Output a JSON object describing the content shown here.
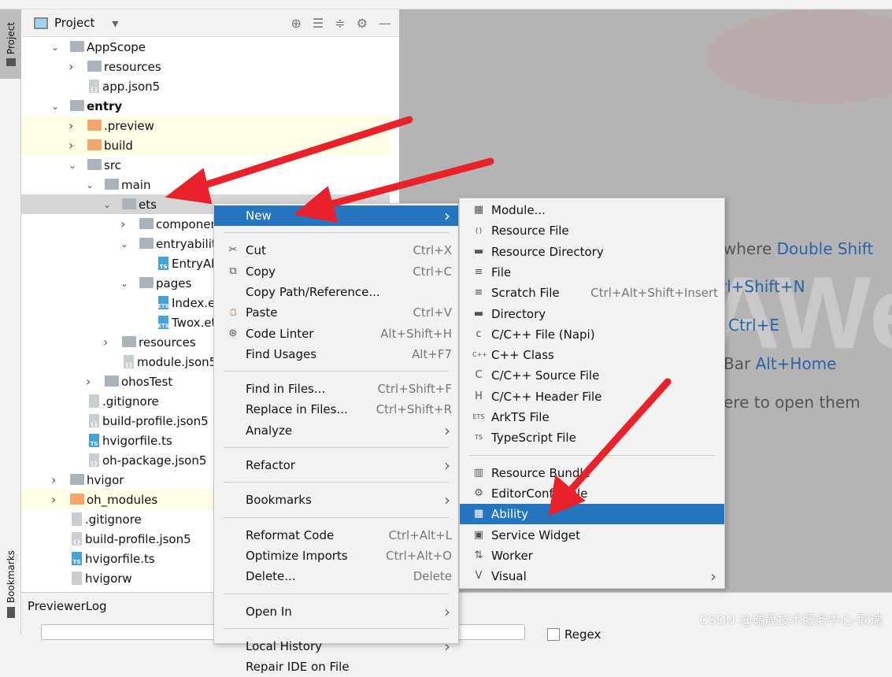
{
  "sidebar_tabs": {
    "project": "Project",
    "bookmarks": "Bookmarks"
  },
  "panel": {
    "title": "Project"
  },
  "tree": [
    {
      "label": "AppScope",
      "level": 0,
      "type": "folder",
      "expanded": true
    },
    {
      "label": "resources",
      "level": 1,
      "type": "folder",
      "expanded": false
    },
    {
      "label": "app.json5",
      "level": 1,
      "type": "json"
    },
    {
      "label": "entry",
      "level": 0,
      "type": "module",
      "expanded": true,
      "bold": true
    },
    {
      "label": ".preview",
      "level": 1,
      "type": "folder-orange",
      "expanded": false,
      "highlight": "yellow"
    },
    {
      "label": "build",
      "level": 1,
      "type": "folder-orange",
      "expanded": false,
      "highlight": "yellow"
    },
    {
      "label": "src",
      "level": 1,
      "type": "folder",
      "expanded": true
    },
    {
      "label": "main",
      "level": 2,
      "type": "folder",
      "expanded": true
    },
    {
      "label": "ets",
      "level": 3,
      "type": "folder",
      "expanded": true,
      "selected": true
    },
    {
      "label": "componen",
      "level": 4,
      "type": "folder",
      "expanded": false
    },
    {
      "label": "entryability",
      "level": 4,
      "type": "folder",
      "expanded": true
    },
    {
      "label": "EntryAb",
      "level": 5,
      "type": "ts"
    },
    {
      "label": "pages",
      "level": 4,
      "type": "folder",
      "expanded": true
    },
    {
      "label": "Index.et",
      "level": 5,
      "type": "ets"
    },
    {
      "label": "Twox.et",
      "level": 5,
      "type": "ets"
    },
    {
      "label": "resources",
      "level": 3,
      "type": "folder",
      "expanded": false
    },
    {
      "label": "module.json5",
      "level": 3,
      "type": "json"
    },
    {
      "label": "ohosTest",
      "level": 2,
      "type": "folder",
      "expanded": false
    },
    {
      "label": ".gitignore",
      "level": 1,
      "type": "file"
    },
    {
      "label": "build-profile.json5",
      "level": 1,
      "type": "json"
    },
    {
      "label": "hvigorfile.ts",
      "level": 1,
      "type": "ts"
    },
    {
      "label": "oh-package.json5",
      "level": 1,
      "type": "json"
    },
    {
      "label": "hvigor",
      "level": 0,
      "type": "folder",
      "expanded": false
    },
    {
      "label": "oh_modules",
      "level": 0,
      "type": "folder-orange",
      "expanded": false,
      "highlight": "yellow"
    },
    {
      "label": ".gitignore",
      "level": 0,
      "type": "file"
    },
    {
      "label": "build-profile.json5",
      "level": 0,
      "type": "json"
    },
    {
      "label": "hvigorfile.ts",
      "level": 0,
      "type": "ts"
    },
    {
      "label": "hvigorw",
      "level": 0,
      "type": "file"
    }
  ],
  "editor_tips": {
    "search": "ywhere",
    "search_key": "Double Shift",
    "goto": "trl+Shift+N",
    "recent": "Ctrl+E",
    "nav": "Bar",
    "nav_key": "Alt+Home",
    "drop": "ere to open them",
    "logo": "AWe"
  },
  "context_menu": [
    {
      "label": "New",
      "submenu": true,
      "highlight": true,
      "mn": "N"
    },
    {
      "sep": true
    },
    {
      "label": "Cut",
      "key": "Ctrl+X",
      "icon": "✂"
    },
    {
      "label": "Copy",
      "key": "Ctrl+C",
      "icon": "⧉"
    },
    {
      "label": "Copy Path/Reference..."
    },
    {
      "label": "Paste",
      "key": "Ctrl+V",
      "icon": "📋"
    },
    {
      "label": "Code Linter",
      "key": "Alt+Shift+H",
      "icon": "⊛"
    },
    {
      "label": "Find Usages",
      "key": "Alt+F7"
    },
    {
      "sep": true
    },
    {
      "label": "Find in Files...",
      "key": "Ctrl+Shift+F"
    },
    {
      "label": "Replace in Files...",
      "key": "Ctrl+Shift+R"
    },
    {
      "label": "Analyze",
      "submenu": true
    },
    {
      "sep": true
    },
    {
      "label": "Refactor",
      "submenu": true
    },
    {
      "sep": true
    },
    {
      "label": "Bookmarks",
      "submenu": true
    },
    {
      "sep": true
    },
    {
      "label": "Reformat Code",
      "key": "Ctrl+Alt+L"
    },
    {
      "label": "Optimize Imports",
      "key": "Ctrl+Alt+O"
    },
    {
      "label": "Delete...",
      "key": "Delete"
    },
    {
      "sep": true
    },
    {
      "label": "Open In",
      "submenu": true
    },
    {
      "sep": true
    },
    {
      "label": "Local History",
      "submenu": true
    },
    {
      "label": "Repair IDE on File"
    }
  ],
  "new_submenu": [
    {
      "label": "Module...",
      "icon": "▦"
    },
    {
      "label": "Resource File",
      "icon": "{}"
    },
    {
      "label": "Resource Directory",
      "icon": "▬"
    },
    {
      "label": "File",
      "icon": "≡"
    },
    {
      "label": "Scratch File",
      "key": "Ctrl+Alt+Shift+Insert",
      "icon": "≡"
    },
    {
      "label": "Directory",
      "icon": "▬"
    },
    {
      "label": "C/C++ File (Napi)",
      "icon": "c"
    },
    {
      "label": "C++ Class",
      "icon": "C++"
    },
    {
      "label": "C/C++ Source File",
      "icon": "C"
    },
    {
      "label": "C/C++ Header File",
      "icon": "H"
    },
    {
      "label": "ArkTS File",
      "icon": "ETS"
    },
    {
      "label": "TypeScript File",
      "icon": "TS"
    },
    {
      "sep": true
    },
    {
      "label": "Resource Bundle",
      "icon": "▥"
    },
    {
      "label": "EditorConfig File",
      "icon": "⚙"
    },
    {
      "label": "Ability",
      "icon": "▦",
      "highlight": true
    },
    {
      "label": "Service Widget",
      "icon": "▣"
    },
    {
      "label": "Worker",
      "icon": "⇅"
    },
    {
      "label": "Visual",
      "icon": "V",
      "submenu": true
    }
  ],
  "bottom": {
    "title": "PreviewerLog",
    "regex": "Regex"
  },
  "watermark": "CSDN @瑞晟技术服务中心-耿瑞",
  "colors": {
    "highlight": "#2675bf",
    "arrow": "#e8212a"
  }
}
